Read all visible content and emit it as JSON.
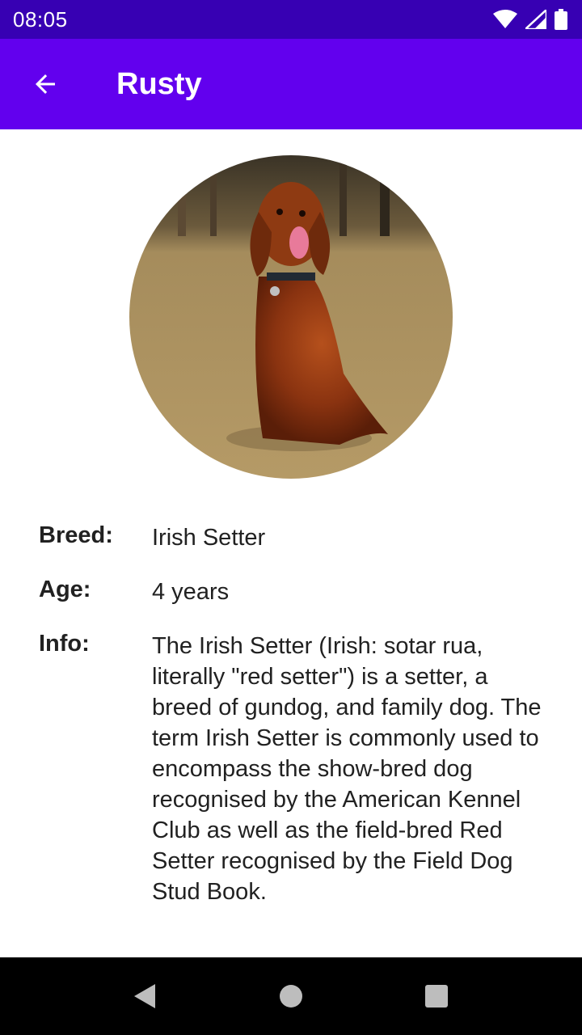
{
  "status_bar": {
    "time": "08:05",
    "icons": [
      "wifi-icon",
      "signal-icon",
      "battery-icon"
    ]
  },
  "app_bar": {
    "back_icon": "arrow-back-icon",
    "title": "Rusty",
    "background": "#6200ee",
    "status_background": "#3700b3"
  },
  "dog": {
    "photo_subject": "Irish Setter dog sitting on grass",
    "breed_label": "Breed:",
    "breed": "Irish Setter",
    "age_label": "Age:",
    "age": "4 years",
    "info_label": "Info:",
    "info": "The Irish Setter (Irish: sotar rua, literally \"red setter\") is a setter, a breed of gundog, and family dog. The term Irish Setter is commonly used to encompass the show-bred dog recognised by the American Kennel Club as well as the field-bred Red Setter recognised by the Field Dog Stud Book."
  },
  "nav_bar": {
    "buttons": [
      "back-triangle-icon",
      "home-circle-icon",
      "recents-square-icon"
    ]
  }
}
